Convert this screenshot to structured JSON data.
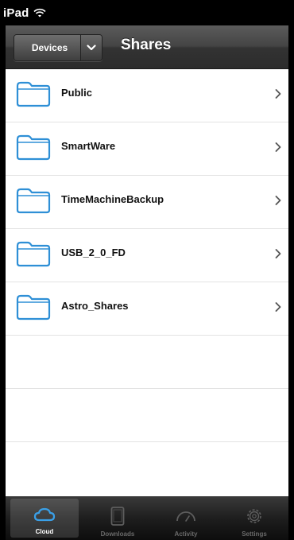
{
  "status_bar": {
    "carrier": "iPad"
  },
  "nav_bar": {
    "back_button_label": "Devices",
    "title": "Shares"
  },
  "shares": [
    {
      "name": "Public"
    },
    {
      "name": "SmartWare"
    },
    {
      "name": "TimeMachineBackup"
    },
    {
      "name": "USB_2_0_FD"
    },
    {
      "name": "Astro_Shares"
    }
  ],
  "tab_bar": {
    "tabs": [
      {
        "label": "Cloud",
        "icon": "cloud-icon",
        "active": true
      },
      {
        "label": "Downloads",
        "icon": "device-icon",
        "active": false
      },
      {
        "label": "Activity",
        "icon": "gauge-icon",
        "active": false
      },
      {
        "label": "Settings",
        "icon": "gear-icon",
        "active": false
      }
    ]
  },
  "colors": {
    "folder_stroke": "#2e8fd6",
    "nav_bar": "#3d3d3d",
    "tab_bar": "#1e1e1e",
    "active_tab_icon": "#3aa0e8"
  }
}
